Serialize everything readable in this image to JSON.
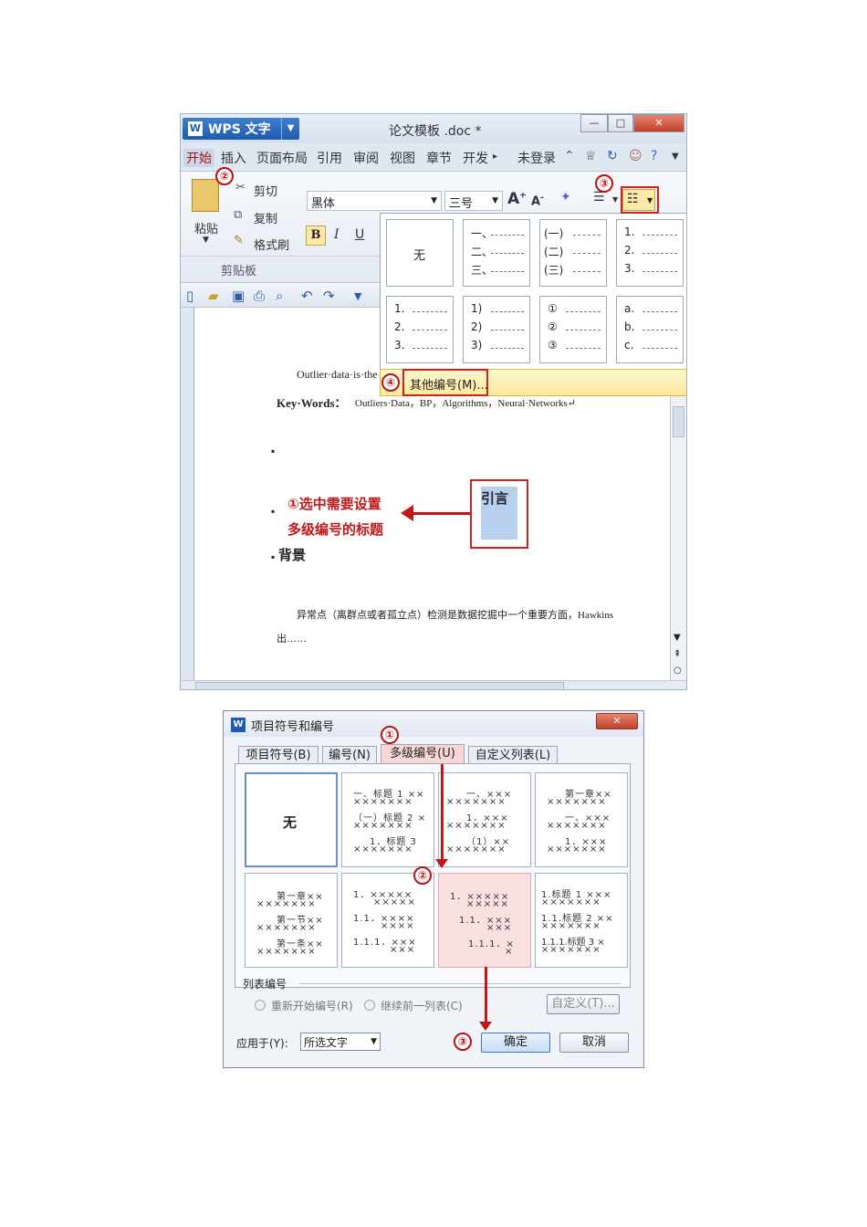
{
  "wps": {
    "app_name": "WPS 文字",
    "doc_title": "论文模板 .doc *",
    "menus": [
      "开始",
      "插入",
      "页面布局",
      "引用",
      "审阅",
      "视图",
      "章节",
      "开发"
    ],
    "login": "未登录",
    "clipboard": {
      "paste": "粘贴",
      "cut": "剪切",
      "copy": "复制",
      "format_painter": "格式刷",
      "group": "剪贴板"
    },
    "font_name": "黑体",
    "font_size": "三号",
    "format": {
      "bold": "B",
      "italic": "I",
      "underline": "U"
    },
    "numbering_menu": {
      "none": "无",
      "cells": [
        [
          "一、",
          "二、",
          "三、"
        ],
        [
          "(一)",
          "(二)",
          "(三)"
        ],
        [
          "1.",
          "2.",
          "3."
        ],
        [
          "1.",
          "2.",
          "3."
        ],
        [
          "1)",
          "2)",
          "3)"
        ],
        [
          "①",
          "②",
          "③"
        ],
        [
          "a.",
          "b.",
          "c."
        ]
      ],
      "other": "其他编号(M)..."
    },
    "document": {
      "outlier_line": "Outlier·data·is·the",
      "keywords_label": "Key·Words：",
      "keywords_value": "Outliers·Data，BP，Algorithms，Neural·Networks↵",
      "heading_intro": "引言",
      "heading_background": "背景",
      "body_line1": "异常点（离群点或者孤立点）检测是数据挖掘中一个重要方面，Hawkins",
      "body_line2": "出……"
    },
    "annotation": {
      "line1": "①选中需要设置",
      "line2": "多级编号的标题"
    },
    "steps": [
      "②",
      "③",
      "④"
    ]
  },
  "dialog": {
    "title": "项目符号和编号",
    "tabs": [
      "项目符号(B)",
      "编号(N)",
      "多级编号(U)",
      "自定义列表(L)"
    ],
    "none": "无",
    "gallery": [
      [
        "一、标题 1 ××",
        "×××××××",
        "（一）标题 2 ×",
        "×××××××",
        "1．标题 3",
        "×××××××"
      ],
      [
        "一、×××",
        "×××××××",
        "1．×××",
        "×××××××",
        "（1）××",
        "×××××××"
      ],
      [
        "第一章××",
        "×××××××",
        "一、×××",
        "×××××××",
        "1．×××",
        "×××××××"
      ],
      [
        "第一章××",
        "×××××××",
        "第一节××",
        "×××××××",
        "第一条××",
        "×××××××"
      ],
      [
        "1．×××××",
        "×××××",
        "1.1．××××",
        "××××",
        "1.1.1．×××",
        "×××"
      ],
      [
        "1．×××××",
        "×××××",
        "1.1．×××",
        "×××",
        "1.1.1．×",
        "×"
      ],
      [
        "1.标题 1 ×××",
        "×××××××",
        "1.1.标题 2 ××",
        "×××××××",
        "1.1.1.标题 3 ×",
        "×××××××"
      ]
    ],
    "list_numbering_label": "列表编号",
    "restart": "重新开始编号(R)",
    "continue": "继续前一列表(C)",
    "customize": "自定义(T)...",
    "apply_to_label": "应用于(Y):",
    "apply_to_value": "所选文字",
    "ok": "确定",
    "cancel": "取消",
    "steps": [
      "①",
      "②",
      "③"
    ]
  }
}
